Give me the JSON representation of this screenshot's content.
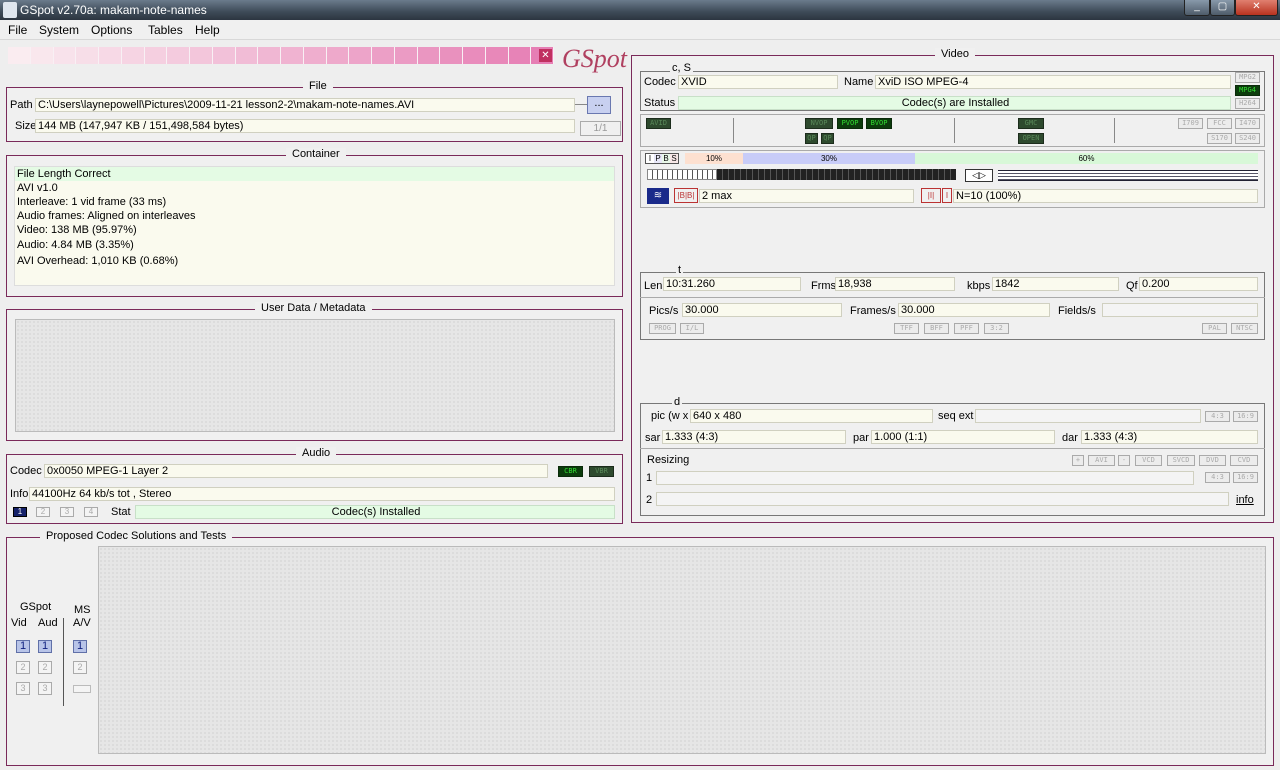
{
  "window": {
    "title": "GSpot v2.70a: makam-note-names",
    "min": "_",
    "max": "▢",
    "close": "✕"
  },
  "menu": [
    "File",
    "System",
    "Options",
    "Tables",
    "Help"
  ],
  "logo": "GSpot",
  "file": {
    "title": "File",
    "path_label": "Path",
    "path": "C:\\Users\\laynepowell\\Pictures\\2009-11-21 lesson2-2\\makam-note-names.AVI",
    "browse": "...",
    "size_label": "Size",
    "size": "144 MB (147,947 KB / 151,498,584 bytes)",
    "counter": "1/1"
  },
  "container": {
    "title": "Container",
    "lines": [
      "File Length Correct",
      "AVI v1.0",
      "Interleave: 1 vid frame (33 ms)",
      "Audio frames: Aligned on interleaves",
      "Video: 138 MB (95.97%)",
      "Audio: 4.84 MB (3.35%)",
      "AVI Overhead: 1,010 KB (0.68%)"
    ]
  },
  "metadata": {
    "title": "User Data / Metadata"
  },
  "audio": {
    "title": "Audio",
    "codec_label": "Codec",
    "codec": "0x0050 MPEG-1 Layer 2",
    "cbr": "CBR",
    "vbr": "VBR",
    "info_label": "Info",
    "info": "44100Hz  64 kb/s tot , Stereo",
    "tabs": [
      "1",
      "2",
      "3",
      "4"
    ],
    "stat_label": "Stat",
    "stat": "Codec(s) Installed"
  },
  "solutions": {
    "title": "Proposed Codec Solutions and Tests",
    "gspot_label": "GSpot",
    "vid_label": "Vid",
    "aud_label": "Aud",
    "ms_label": "MS",
    "av_label": "A/V",
    "buttons": [
      "1",
      "2",
      "3"
    ]
  },
  "video": {
    "title": "Video",
    "cs_label": "c, S",
    "codec_label": "Codec",
    "codec": "XVID",
    "name_label": "Name",
    "name": "XviD ISO MPEG-4",
    "status_label": "Status",
    "status": "Codec(s) are Installed",
    "side_tags": [
      "MPG2",
      "MPG4",
      "H264"
    ],
    "flag_tags": [
      "AVID",
      "NVOP",
      "PVOP",
      "BVOP",
      "QP",
      "GMC",
      "I709",
      "FCC",
      "I470",
      "OPEN",
      "S170",
      "S240"
    ],
    "frame_types": [
      "I",
      "P",
      "B",
      "S"
    ],
    "percent_labels": [
      "10%",
      "30%",
      "60%"
    ],
    "bframes": "2 max",
    "gop": "N=10 (100%)",
    "t_label": "t",
    "len_label": "Len",
    "len": "10:31.260",
    "frms_label": "Frms",
    "frms": "18,938",
    "kbps_label": "kbps",
    "kbps": "1842",
    "qf_label": "Qf",
    "qf": "0.200",
    "pics_label": "Pics/s",
    "pics": "30.000",
    "frames_label": "Frames/s",
    "frames": "30.000",
    "fields_label": "Fields/s",
    "mode_tags": [
      "PROG",
      "I/L",
      "TFF",
      "BFF",
      "PFF",
      "3:2",
      "PAL",
      "NTSC"
    ],
    "d_label": "d",
    "pic_label": "pic (w x",
    "pic": "640 x 480",
    "seqext_label": "seq ext",
    "aspect_tags": [
      "4:3",
      "16:9"
    ],
    "sar_label": "sar",
    "sar": "1.333 (4:3)",
    "par_label": "par",
    "par": "1.000 (1:1)",
    "dar_label": "dar",
    "dar": "1.333 (4:3)",
    "resizing_label": "Resizing",
    "resize_tags": [
      "+",
      "AVI",
      "-",
      "VCD",
      "SVCD",
      "DVD",
      "CVD"
    ],
    "row1": "1",
    "row2": "2",
    "info_link": "info"
  }
}
